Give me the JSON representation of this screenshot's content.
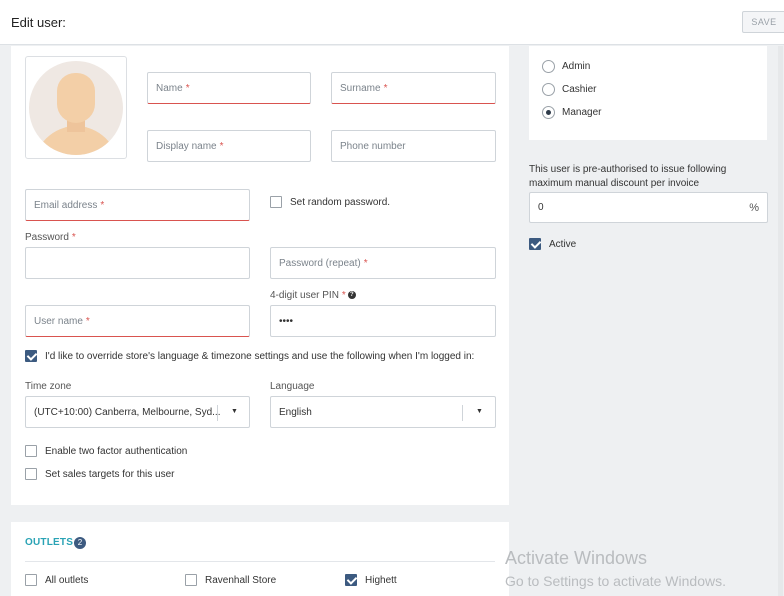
{
  "header": {
    "title": "Edit user:",
    "save_label": "SAVE"
  },
  "form": {
    "name_placeholder": "Name",
    "surname_placeholder": "Surname",
    "display_name_placeholder": "Display name",
    "phone_placeholder": "Phone number",
    "email_placeholder": "Email address",
    "random_password_label": "Set random password.",
    "password_label": "Password",
    "password_repeat_placeholder": "Password (repeat)",
    "pin_label": "4-digit user PIN",
    "pin_value": "••••",
    "username_placeholder": "User name",
    "required_mark": "*",
    "override_label": "I'd like to override store's language & timezone settings and use the following when I'm logged in:",
    "timezone_label": "Time zone",
    "timezone_value": "(UTC+10:00) Canberra, Melbourne, Syd...",
    "language_label": "Language",
    "language_value": "English",
    "two_factor_label": "Enable two factor authentication",
    "sales_targets_label": "Set sales targets for this user"
  },
  "roles": {
    "options": [
      "Admin",
      "Cashier",
      "Manager"
    ],
    "selected": "Manager"
  },
  "discount": {
    "text": "This user is pre-authorised to issue following maximum manual discount per invoice",
    "value": "0",
    "unit": "%"
  },
  "active_label": "Active",
  "outlets": {
    "title": "OUTLETS",
    "count": "2",
    "items": [
      {
        "label": "All outlets",
        "checked": false
      },
      {
        "label": "Ravenhall Store",
        "checked": false
      },
      {
        "label": "Highett",
        "checked": true
      }
    ]
  },
  "watermark": {
    "line1": "Activate Windows",
    "line2": "Go to Settings to activate Windows."
  },
  "colors": {
    "accent": "#2aa3b5",
    "error": "#d9534f",
    "checkbox": "#3c5a80"
  }
}
